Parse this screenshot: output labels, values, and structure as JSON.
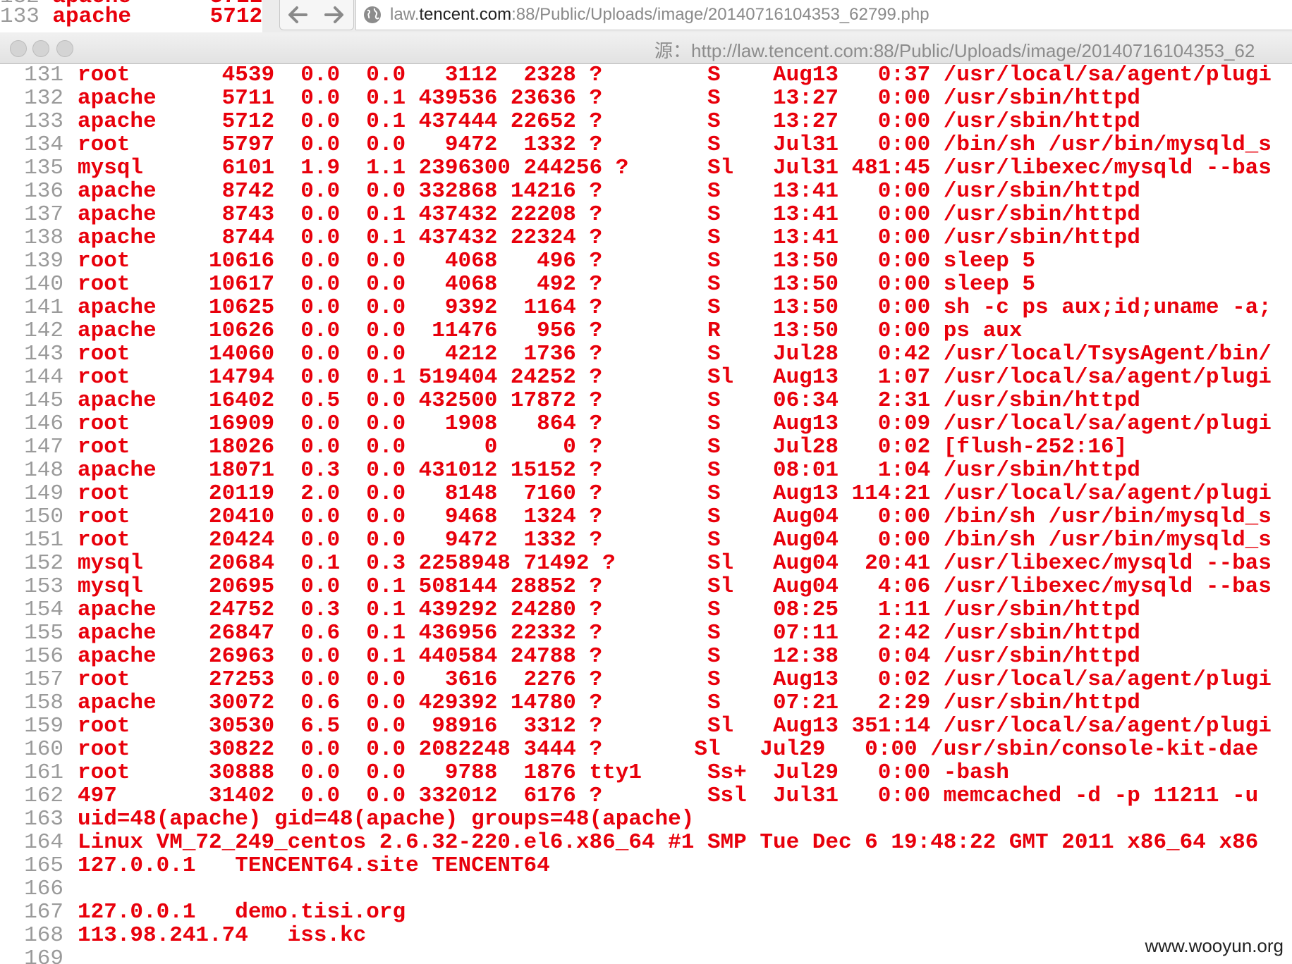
{
  "background_tab": {
    "partial_line": {
      "num": "132",
      "text": "apache      5711"
    },
    "line": {
      "num": "133",
      "text": "apache      5712"
    }
  },
  "address_bar": {
    "url_prefix": "law.",
    "url_domain": "tencent.com",
    "url_rest": ":88/Public/Uploads/image/20140716104353_62799.php"
  },
  "window": {
    "title": "源：http://law.tencent.com:88/Public/Uploads/image/20140716104353_62"
  },
  "source_lines": [
    {
      "num": "131",
      "text": "root       4539  0.0  0.0   3112  2328 ?        S    Aug13   0:37 /usr/local/sa/agent/plugi"
    },
    {
      "num": "132",
      "text": "apache     5711  0.0  0.1 439536 23636 ?        S    13:27   0:00 /usr/sbin/httpd"
    },
    {
      "num": "133",
      "text": "apache     5712  0.0  0.1 437444 22652 ?        S    13:27   0:00 /usr/sbin/httpd"
    },
    {
      "num": "134",
      "text": "root       5797  0.0  0.0   9472  1332 ?        S    Jul31   0:00 /bin/sh /usr/bin/mysqld_s"
    },
    {
      "num": "135",
      "text": "mysql      6101  1.9  1.1 2396300 244256 ?      Sl   Jul31 481:45 /usr/libexec/mysqld --bas"
    },
    {
      "num": "136",
      "text": "apache     8742  0.0  0.0 332868 14216 ?        S    13:41   0:00 /usr/sbin/httpd"
    },
    {
      "num": "137",
      "text": "apache     8743  0.0  0.1 437432 22208 ?        S    13:41   0:00 /usr/sbin/httpd"
    },
    {
      "num": "138",
      "text": "apache     8744  0.0  0.1 437432 22324 ?        S    13:41   0:00 /usr/sbin/httpd"
    },
    {
      "num": "139",
      "text": "root      10616  0.0  0.0   4068   496 ?        S    13:50   0:00 sleep 5"
    },
    {
      "num": "140",
      "text": "root      10617  0.0  0.0   4068   492 ?        S    13:50   0:00 sleep 5"
    },
    {
      "num": "141",
      "text": "apache    10625  0.0  0.0   9392  1164 ?        S    13:50   0:00 sh -c ps aux;id;uname -a;"
    },
    {
      "num": "142",
      "text": "apache    10626  0.0  0.0  11476   956 ?        R    13:50   0:00 ps aux"
    },
    {
      "num": "143",
      "text": "root      14060  0.0  0.0   4212  1736 ?        S    Jul28   0:42 /usr/local/TsysAgent/bin/"
    },
    {
      "num": "144",
      "text": "root      14794  0.0  0.1 519404 24252 ?        Sl   Aug13   1:07 /usr/local/sa/agent/plugi"
    },
    {
      "num": "145",
      "text": "apache    16402  0.5  0.0 432500 17872 ?        S    06:34   2:31 /usr/sbin/httpd"
    },
    {
      "num": "146",
      "text": "root      16909  0.0  0.0   1908   864 ?        S    Aug13   0:09 /usr/local/sa/agent/plugi"
    },
    {
      "num": "147",
      "text": "root      18026  0.0  0.0      0     0 ?        S    Jul28   0:02 [flush-252:16]"
    },
    {
      "num": "148",
      "text": "apache    18071  0.3  0.0 431012 15152 ?        S    08:01   1:04 /usr/sbin/httpd"
    },
    {
      "num": "149",
      "text": "root      20119  2.0  0.0   8148  7160 ?        S    Aug13 114:21 /usr/local/sa/agent/plugi"
    },
    {
      "num": "150",
      "text": "root      20410  0.0  0.0   9468  1324 ?        S    Aug04   0:00 /bin/sh /usr/bin/mysqld_s"
    },
    {
      "num": "151",
      "text": "root      20424  0.0  0.0   9472  1332 ?        S    Aug04   0:00 /bin/sh /usr/bin/mysqld_s"
    },
    {
      "num": "152",
      "text": "mysql     20684  0.1  0.3 2258948 71492 ?       Sl   Aug04  20:41 /usr/libexec/mysqld --bas"
    },
    {
      "num": "153",
      "text": "mysql     20695  0.0  0.1 508144 28852 ?        Sl   Aug04   4:06 /usr/libexec/mysqld --bas"
    },
    {
      "num": "154",
      "text": "apache    24752  0.3  0.1 439292 24280 ?        S    08:25   1:11 /usr/sbin/httpd"
    },
    {
      "num": "155",
      "text": "apache    26847  0.6  0.1 436956 22332 ?        S    07:11   2:42 /usr/sbin/httpd"
    },
    {
      "num": "156",
      "text": "apache    26963  0.0  0.1 440584 24788 ?        S    12:38   0:04 /usr/sbin/httpd"
    },
    {
      "num": "157",
      "text": "root      27253  0.0  0.0   3616  2276 ?        S    Aug13   0:02 /usr/local/sa/agent/plugi"
    },
    {
      "num": "158",
      "text": "apache    30072  0.6  0.0 429392 14780 ?        S    07:21   2:29 /usr/sbin/httpd"
    },
    {
      "num": "159",
      "text": "root      30530  6.5  0.0  98916  3312 ?        Sl   Aug13 351:14 /usr/local/sa/agent/plugi"
    },
    {
      "num": "160",
      "text": "root      30822  0.0  0.0 2082248 3444 ?       Sl   Jul29   0:00 /usr/sbin/console-kit-dae"
    },
    {
      "num": "161",
      "text": "root      30888  0.0  0.0   9788  1876 tty1     Ss+  Jul29   0:00 -bash"
    },
    {
      "num": "162",
      "text": "497       31402  0.0  0.0 332012  6176 ?        Ssl  Jul31   0:00 memcached -d -p 11211 -u "
    },
    {
      "num": "163",
      "text": "uid=48(apache) gid=48(apache) groups=48(apache)"
    },
    {
      "num": "164",
      "text": "Linux VM_72_249_centos 2.6.32-220.el6.x86_64 #1 SMP Tue Dec 6 19:48:22 GMT 2011 x86_64 x86"
    },
    {
      "num": "165",
      "text": "127.0.0.1   TENCENT64.site TENCENT64"
    },
    {
      "num": "166",
      "text": ""
    },
    {
      "num": "167",
      "text": "127.0.0.1   demo.tisi.org"
    },
    {
      "num": "168",
      "text": "113.98.241.74   iss.kc"
    },
    {
      "num": "169",
      "text": ""
    }
  ],
  "watermark": "www.wooyun.org",
  "colors": {
    "text": "#e8000b",
    "line_number": "#9a9a9a"
  }
}
